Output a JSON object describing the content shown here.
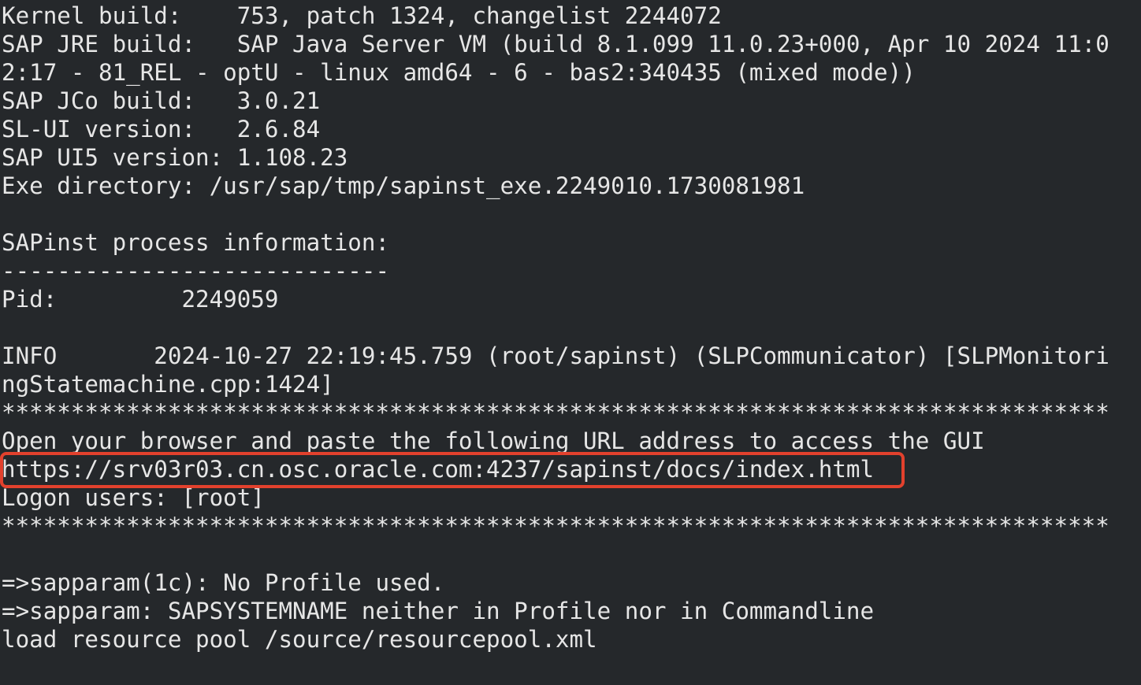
{
  "terminal": {
    "lines": [
      "Kernel build:    753, patch 1324, changelist 2244072",
      "SAP JRE build:   SAP Java Server VM (build 8.1.099 11.0.23+000, Apr 10 2024 11:0",
      "2:17 - 81_REL - optU - linux amd64 - 6 - bas2:340435 (mixed mode))",
      "SAP JCo build:   3.0.21",
      "SL-UI version:   2.6.84",
      "SAP UI5 version: 1.108.23",
      "Exe directory: /usr/sap/tmp/sapinst_exe.2249010.1730081981",
      "",
      "SAPinst process information:",
      "----------------------------",
      "Pid:         2249059",
      "",
      "INFO       2024-10-27 22:19:45.759 (root/sapinst) (SLPCommunicator) [SLPMonitori",
      "ngStatemachine.cpp:1424]",
      "********************************************************************************",
      "Open your browser and paste the following URL address to access the GUI",
      "https://srv03r03.cn.osc.oracle.com:4237/sapinst/docs/index.html",
      "Logon users: [root]",
      "********************************************************************************",
      "",
      "=>sapparam(1c): No Profile used.",
      "=>sapparam: SAPSYSTEMNAME neither in Profile nor in Commandline",
      "load resource pool /source/resourcepool.xml",
      ""
    ],
    "highlight_color": "#e2412d",
    "background_color": "#25282b",
    "text_color": "#e6e6e6"
  }
}
